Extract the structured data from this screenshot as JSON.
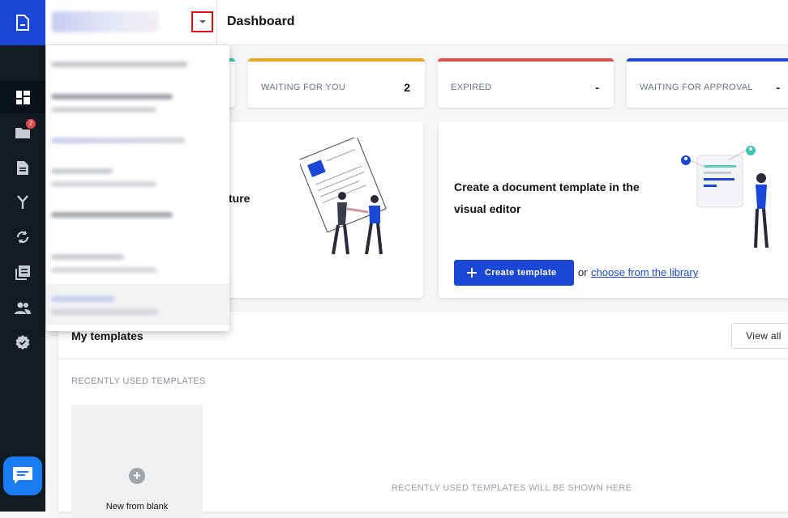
{
  "header": {
    "page_title": "Dashboard",
    "workspace_dropdown": "expanded"
  },
  "sidebar": {
    "items": [
      {
        "icon": "dashboard-icon",
        "active": true
      },
      {
        "icon": "folder-icon",
        "badge": "2"
      },
      {
        "icon": "document-icon"
      },
      {
        "icon": "workflow-icon"
      },
      {
        "icon": "sync-icon"
      },
      {
        "icon": "library-icon"
      },
      {
        "icon": "contacts-icon"
      },
      {
        "icon": "settings-badge-icon"
      }
    ],
    "chat_icon": "chat-icon"
  },
  "stats": [
    {
      "label": "WAITING FOR YOU",
      "value": "2",
      "color": "#e4a72a"
    },
    {
      "label": "EXPIRED",
      "value": "-",
      "color": "#e05050"
    },
    {
      "label": "WAITING FOR APPROVAL",
      "value": "-",
      "color": "#1a47d6"
    }
  ],
  "promo_left": {
    "heading_visible_fragment": "ture"
  },
  "promo_right": {
    "heading": "Create a document template in the visual editor",
    "create_button": "Create template",
    "or_text": "or",
    "library_link": "choose from the library"
  },
  "templates": {
    "heading": "My templates",
    "view_all": "View all",
    "recent_heading": "RECENTLY USED TEMPLATES",
    "new_blank": "New from blank",
    "empty_message": "RECENTLY USED TEMPLATES WILL BE SHOWN HERE"
  },
  "colors": {
    "brand": "#1a47d6",
    "sidebar": "#121a23",
    "chat": "#1a7cf5",
    "highlight": "#e01010"
  }
}
